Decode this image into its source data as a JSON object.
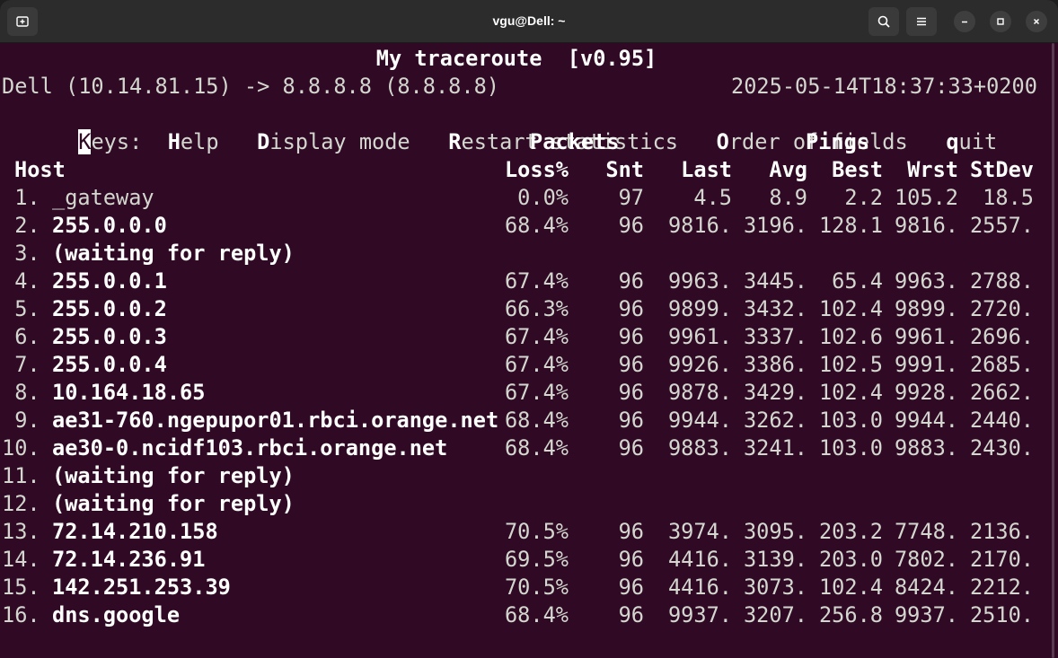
{
  "window": {
    "title": "vgu@Dell: ~",
    "icons": {
      "new_tab": "new-tab-icon",
      "search": "search-icon",
      "menu": "hamburger-menu-icon",
      "minimize": "minimize-icon",
      "maximize": "maximize-icon",
      "close": "close-icon"
    }
  },
  "mtr": {
    "title": "My traceroute  [v0.95]",
    "route": "Dell (10.14.81.15) -> 8.8.8.8 (8.8.8.8)",
    "timestamp": "2025-05-14T18:37:33+0200",
    "keys": {
      "prefix_cursor": "K",
      "prefix_rest": "eys:",
      "help_key": "H",
      "help_rest": "elp",
      "display_key": "D",
      "display_rest": "isplay mode",
      "restart_key": "R",
      "restart_rest": "estart statistics",
      "order_key": "O",
      "order_rest": "rder of fields",
      "quit_key": "q",
      "quit_rest": "uit"
    },
    "group_headers": {
      "packets": "Packets",
      "pings": "Pings"
    },
    "columns": {
      "host": "Host",
      "loss": "Loss%",
      "snt": "Snt",
      "last": "Last",
      "avg": "Avg",
      "best": "Best",
      "wrst": "Wrst",
      "stdev": "StDev"
    },
    "rows": [
      {
        "num": " 1.",
        "host": "_gateway",
        "bold": false,
        "loss": "0.0%",
        "snt": "97",
        "last": "4.5",
        "avg": "8.9",
        "best": "2.2",
        "wrst": "105.2",
        "stdev": "18.5"
      },
      {
        "num": " 2.",
        "host": "255.0.0.0",
        "bold": true,
        "loss": "68.4%",
        "snt": "96",
        "last": "9816.",
        "avg": "3196.",
        "best": "128.1",
        "wrst": "9816.",
        "stdev": "2557."
      },
      {
        "num": " 3.",
        "host": "(waiting for reply)",
        "bold": true,
        "loss": "",
        "snt": "",
        "last": "",
        "avg": "",
        "best": "",
        "wrst": "",
        "stdev": ""
      },
      {
        "num": " 4.",
        "host": "255.0.0.1",
        "bold": true,
        "loss": "67.4%",
        "snt": "96",
        "last": "9963.",
        "avg": "3445.",
        "best": "65.4",
        "wrst": "9963.",
        "stdev": "2788."
      },
      {
        "num": " 5.",
        "host": "255.0.0.2",
        "bold": true,
        "loss": "66.3%",
        "snt": "96",
        "last": "9899.",
        "avg": "3432.",
        "best": "102.4",
        "wrst": "9899.",
        "stdev": "2720."
      },
      {
        "num": " 6.",
        "host": "255.0.0.3",
        "bold": true,
        "loss": "67.4%",
        "snt": "96",
        "last": "9961.",
        "avg": "3337.",
        "best": "102.6",
        "wrst": "9961.",
        "stdev": "2696."
      },
      {
        "num": " 7.",
        "host": "255.0.0.4",
        "bold": true,
        "loss": "67.4%",
        "snt": "96",
        "last": "9926.",
        "avg": "3386.",
        "best": "102.5",
        "wrst": "9991.",
        "stdev": "2685."
      },
      {
        "num": " 8.",
        "host": "10.164.18.65",
        "bold": true,
        "loss": "67.4%",
        "snt": "96",
        "last": "9878.",
        "avg": "3429.",
        "best": "102.4",
        "wrst": "9928.",
        "stdev": "2662."
      },
      {
        "num": " 9.",
        "host": "ae31-760.ngepupor01.rbci.orange.net",
        "bold": true,
        "loss": "68.4%",
        "snt": "96",
        "last": "9944.",
        "avg": "3262.",
        "best": "103.0",
        "wrst": "9944.",
        "stdev": "2440."
      },
      {
        "num": "10.",
        "host": "ae30-0.ncidf103.rbci.orange.net",
        "bold": true,
        "loss": "68.4%",
        "snt": "96",
        "last": "9883.",
        "avg": "3241.",
        "best": "103.0",
        "wrst": "9883.",
        "stdev": "2430."
      },
      {
        "num": "11.",
        "host": "(waiting for reply)",
        "bold": true,
        "loss": "",
        "snt": "",
        "last": "",
        "avg": "",
        "best": "",
        "wrst": "",
        "stdev": ""
      },
      {
        "num": "12.",
        "host": "(waiting for reply)",
        "bold": true,
        "loss": "",
        "snt": "",
        "last": "",
        "avg": "",
        "best": "",
        "wrst": "",
        "stdev": ""
      },
      {
        "num": "13.",
        "host": "72.14.210.158",
        "bold": true,
        "loss": "70.5%",
        "snt": "96",
        "last": "3974.",
        "avg": "3095.",
        "best": "203.2",
        "wrst": "7748.",
        "stdev": "2136."
      },
      {
        "num": "14.",
        "host": "72.14.236.91",
        "bold": true,
        "loss": "69.5%",
        "snt": "96",
        "last": "4416.",
        "avg": "3139.",
        "best": "203.0",
        "wrst": "7802.",
        "stdev": "2170."
      },
      {
        "num": "15.",
        "host": "142.251.253.39",
        "bold": true,
        "loss": "70.5%",
        "snt": "96",
        "last": "4416.",
        "avg": "3073.",
        "best": "102.4",
        "wrst": "8424.",
        "stdev": "2212."
      },
      {
        "num": "16.",
        "host": "dns.google",
        "bold": true,
        "loss": "68.4%",
        "snt": "96",
        "last": "9937.",
        "avg": "3207.",
        "best": "256.8",
        "wrst": "9937.",
        "stdev": "2510."
      }
    ]
  },
  "colors": {
    "terminal_bg": "#300a24",
    "terminal_fg": "#d3d7cf",
    "bold_fg": "#ffffff",
    "titlebar_bg": "#2c2c2c"
  }
}
